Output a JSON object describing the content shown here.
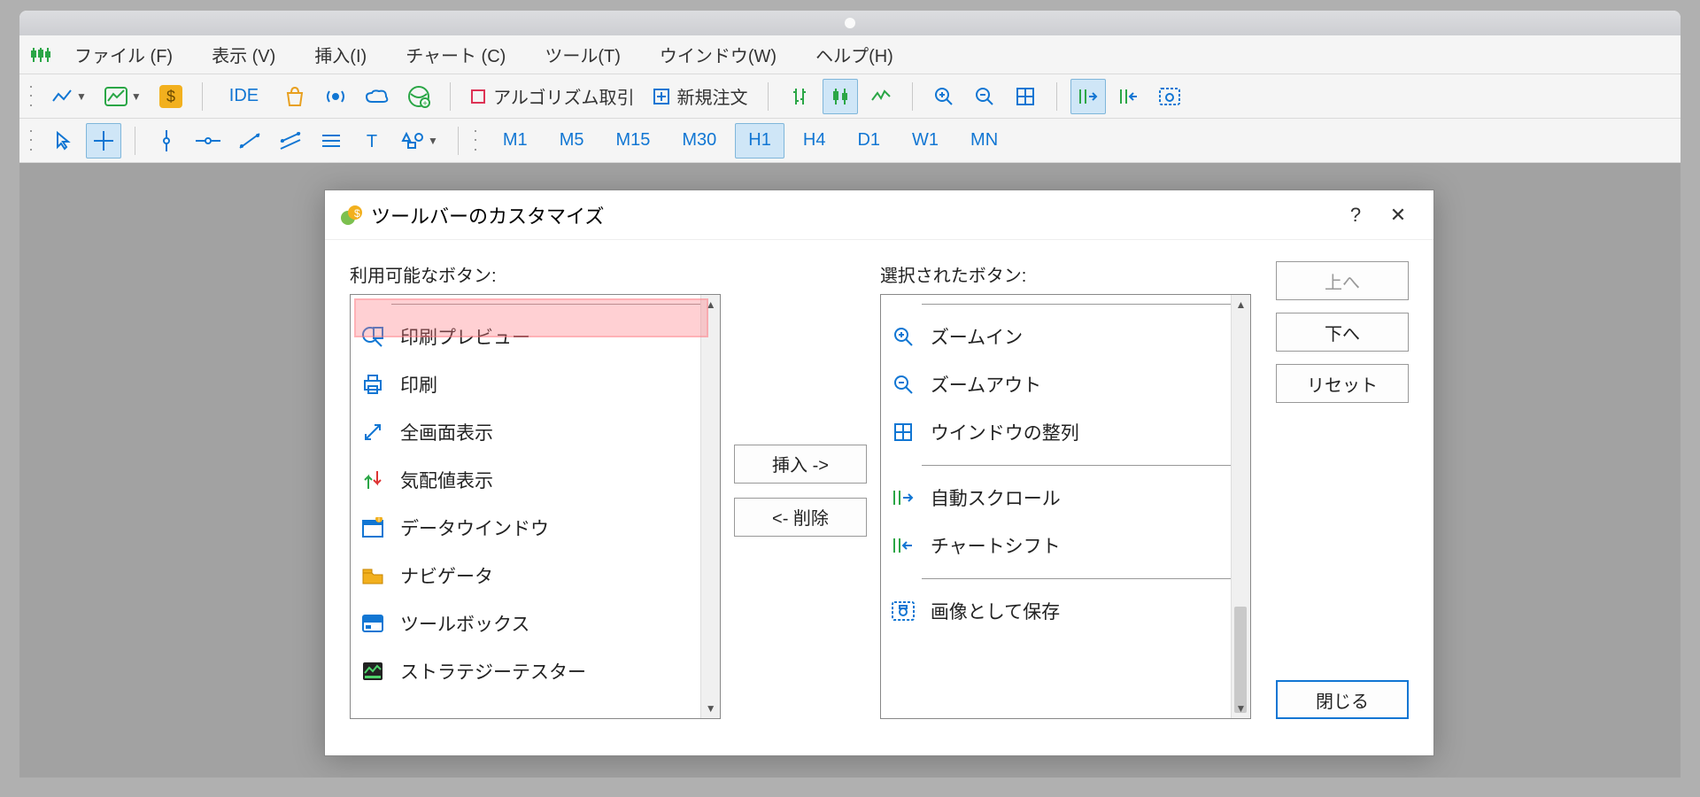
{
  "menu": {
    "file": "ファイル (F)",
    "view": "表示 (V)",
    "insert": "挿入(I)",
    "chart": "チャート (C)",
    "tools": "ツール(T)",
    "window": "ウインドウ(W)",
    "help": "ヘルプ(H)"
  },
  "toolbar1": {
    "ide": "IDE",
    "algo": "アルゴリズム取引",
    "new_order": "新規注文"
  },
  "toolbar2": {
    "timeframes": [
      "M1",
      "M5",
      "M15",
      "M30",
      "H1",
      "H4",
      "D1",
      "W1",
      "MN"
    ],
    "active_tf": "H1"
  },
  "dialog": {
    "title": "ツールバーのカスタマイズ",
    "available_label": "利用可能なボタン:",
    "selected_label": "選択されたボタン:",
    "available": [
      {
        "kind": "sep"
      },
      {
        "icon": "preview",
        "label": "印刷プレビュー"
      },
      {
        "icon": "print",
        "label": "印刷"
      },
      {
        "icon": "fullscreen",
        "label": "全画面表示"
      },
      {
        "icon": "quotes",
        "label": "気配値表示"
      },
      {
        "icon": "datawin",
        "label": "データウインドウ"
      },
      {
        "icon": "navigator",
        "label": "ナビゲータ"
      },
      {
        "icon": "toolbox",
        "label": "ツールボックス"
      },
      {
        "icon": "tester",
        "label": "ストラテジーテスター"
      }
    ],
    "selected": [
      {
        "kind": "sep"
      },
      {
        "icon": "zoom-in",
        "label": "ズームイン"
      },
      {
        "icon": "zoom-out",
        "label": "ズームアウト"
      },
      {
        "icon": "tile",
        "label": "ウインドウの整列"
      },
      {
        "kind": "sep"
      },
      {
        "icon": "autoscroll",
        "label": "自動スクロール"
      },
      {
        "icon": "chartshift",
        "label": "チャートシフト"
      },
      {
        "kind": "sep"
      },
      {
        "icon": "screenshot",
        "label": "画像として保存"
      }
    ],
    "insert_btn": "挿入 ->",
    "remove_btn": "<- 削除",
    "up_btn": "上へ",
    "down_btn": "下へ",
    "reset_btn": "リセット",
    "close_btn": "閉じる"
  }
}
